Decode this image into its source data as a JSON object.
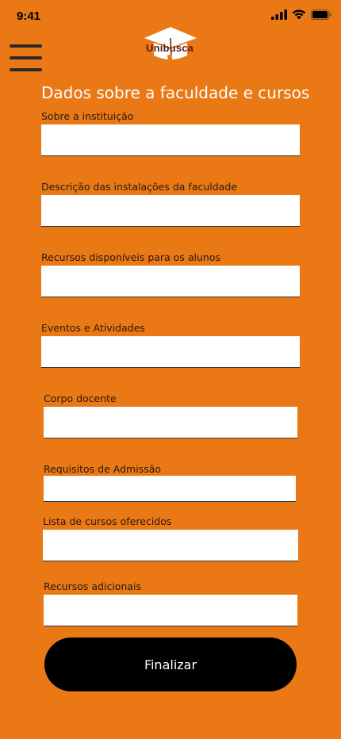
{
  "status_bar": {
    "time": "9:41"
  },
  "header": {
    "logo_text": "Unibusca"
  },
  "form": {
    "title": "Dados sobre a faculdade e cursos",
    "fields": [
      {
        "label": "Sobre a instituição",
        "value": ""
      },
      {
        "label": "Descrição das instalações da faculdade",
        "value": ""
      },
      {
        "label": "Recursos disponíveis para os alunos",
        "value": ""
      },
      {
        "label": "Eventos e Atividades",
        "value": ""
      },
      {
        "label": "Corpo docente",
        "value": ""
      },
      {
        "label": "Requisitos de Admissão",
        "value": ""
      },
      {
        "label": "Lista de cursos oferecidos",
        "value": ""
      },
      {
        "label": "Recursos adicionais",
        "value": ""
      }
    ],
    "submit_label": "Finalizar"
  },
  "colors": {
    "background": "#E97815",
    "button": "#000000",
    "input": "#FFFFFF",
    "title": "#FFFFFF"
  },
  "icons": [
    "signal-icon",
    "wifi-icon",
    "battery-icon",
    "menu-icon",
    "graduation-cap-icon"
  ]
}
